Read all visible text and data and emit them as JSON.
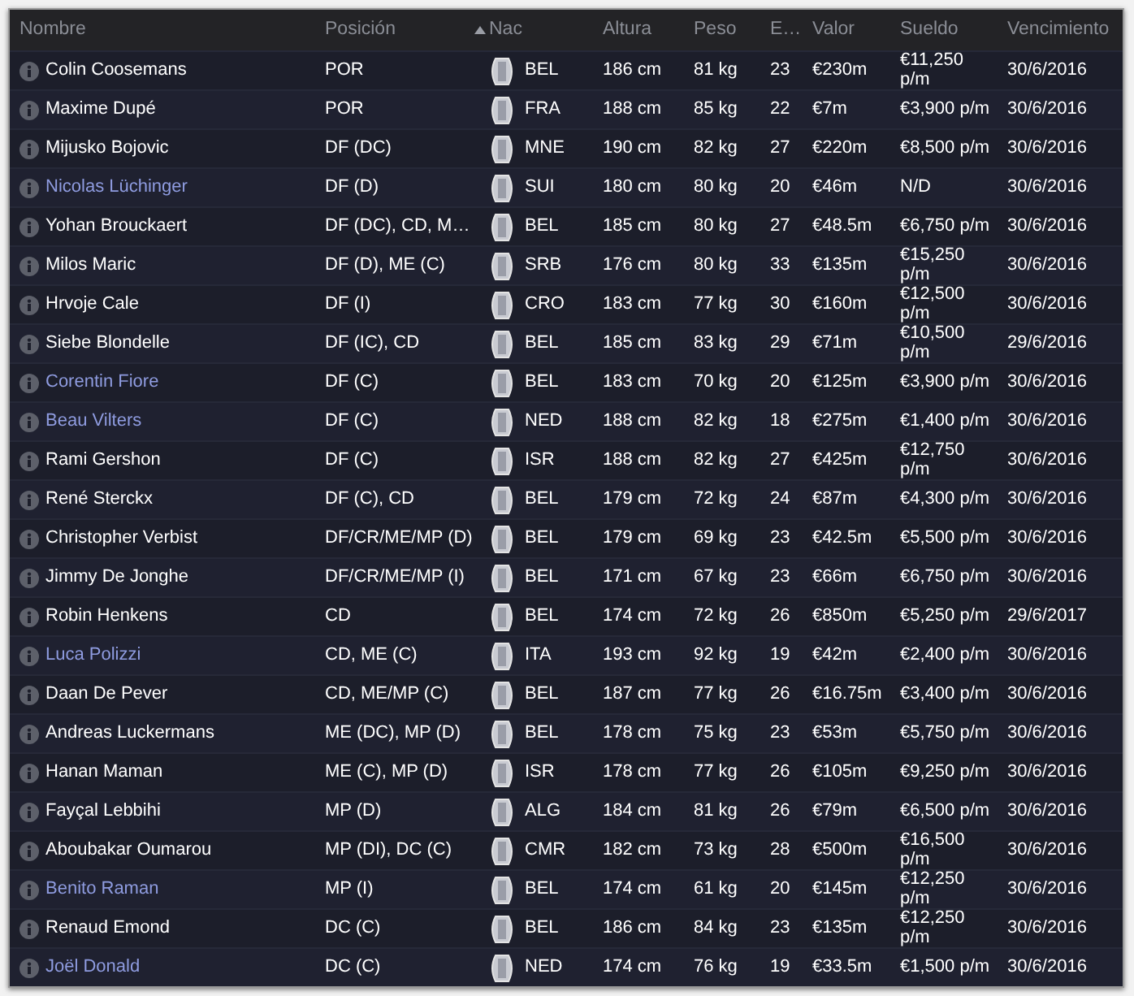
{
  "columns": [
    {
      "label": "Nombre",
      "sorted": false
    },
    {
      "label": "Posición",
      "sorted": false
    },
    {
      "label": "Nac",
      "sorted": true
    },
    {
      "label": "Altura",
      "sorted": false
    },
    {
      "label": "Peso",
      "sorted": false
    },
    {
      "label": "E…",
      "sorted": false
    },
    {
      "label": "Valor",
      "sorted": false
    },
    {
      "label": "Sueldo",
      "sorted": false
    },
    {
      "label": "Vencimiento",
      "sorted": false
    }
  ],
  "rows": [
    {
      "name": "Colin Coosemans",
      "color": "#ffffff",
      "position": "POR",
      "nation": "BEL",
      "height": "186 cm",
      "weight": "81 kg",
      "column_6": "23",
      "value": "€230m",
      "wage": "€11,250 p/m",
      "expiry": "30/6/2016"
    },
    {
      "name": "Maxime Dupé",
      "color": "#ffffff",
      "position": "POR",
      "nation": "FRA",
      "height": "188 cm",
      "weight": "85 kg",
      "column_6": "22",
      "value": "€7m",
      "wage": "€3,900 p/m",
      "expiry": "30/6/2016"
    },
    {
      "name": "Mijusko Bojovic",
      "color": "#ffffff",
      "position": "DF (DC)",
      "nation": "MNE",
      "height": "190 cm",
      "weight": "82 kg",
      "column_6": "27",
      "value": "€220m",
      "wage": "€8,500 p/m",
      "expiry": "30/6/2016"
    },
    {
      "name": "Nicolas Lüchinger",
      "color": "#8f9ce0",
      "position": "DF (D)",
      "nation": "SUI",
      "height": "180 cm",
      "weight": "80 kg",
      "column_6": "20",
      "value": "€46m",
      "wage": "N/D",
      "expiry": "30/6/2016"
    },
    {
      "name": "Yohan Brouckaert",
      "color": "#ffffff",
      "position": "DF (DC), CD, M…",
      "nation": "BEL",
      "height": "185 cm",
      "weight": "80 kg",
      "column_6": "27",
      "value": "€48.5m",
      "wage": "€6,750 p/m",
      "expiry": "30/6/2016"
    },
    {
      "name": "Milos Maric",
      "color": "#ffffff",
      "position": "DF (D), ME (C)",
      "nation": "SRB",
      "height": "176 cm",
      "weight": "80 kg",
      "column_6": "33",
      "value": "€135m",
      "wage": "€15,250 p/m",
      "expiry": "30/6/2016"
    },
    {
      "name": "Hrvoje Cale",
      "color": "#ffffff",
      "position": "DF (I)",
      "nation": "CRO",
      "height": "183 cm",
      "weight": "77 kg",
      "column_6": "30",
      "value": "€160m",
      "wage": "€12,500 p/m",
      "expiry": "30/6/2016"
    },
    {
      "name": "Siebe Blondelle",
      "color": "#ffffff",
      "position": "DF (IC), CD",
      "nation": "BEL",
      "height": "185 cm",
      "weight": "83 kg",
      "column_6": "29",
      "value": "€71m",
      "wage": "€10,500 p/m",
      "expiry": "29/6/2016"
    },
    {
      "name": "Corentin Fiore",
      "color": "#8f9ce0",
      "position": "DF (C)",
      "nation": "BEL",
      "height": "183 cm",
      "weight": "70 kg",
      "column_6": "20",
      "value": "€125m",
      "wage": "€3,900 p/m",
      "expiry": "30/6/2016"
    },
    {
      "name": "Beau Vilters",
      "color": "#8f9ce0",
      "position": "DF (C)",
      "nation": "NED",
      "height": "188 cm",
      "weight": "82 kg",
      "column_6": "18",
      "value": "€275m",
      "wage": "€1,400 p/m",
      "expiry": "30/6/2016"
    },
    {
      "name": "Rami Gershon",
      "color": "#ffffff",
      "position": "DF (C)",
      "nation": "ISR",
      "height": "188 cm",
      "weight": "82 kg",
      "column_6": "27",
      "value": "€425m",
      "wage": "€12,750 p/m",
      "expiry": "30/6/2016"
    },
    {
      "name": "René Sterckx",
      "color": "#ffffff",
      "position": "DF (C), CD",
      "nation": "BEL",
      "height": "179 cm",
      "weight": "72 kg",
      "column_6": "24",
      "value": "€87m",
      "wage": "€4,300 p/m",
      "expiry": "30/6/2016"
    },
    {
      "name": "Christopher Verbist",
      "color": "#ffffff",
      "position": "DF/CR/ME/MP (D)",
      "nation": "BEL",
      "height": "179 cm",
      "weight": "69 kg",
      "column_6": "23",
      "value": "€42.5m",
      "wage": "€5,500 p/m",
      "expiry": "30/6/2016"
    },
    {
      "name": "Jimmy De Jonghe",
      "color": "#ffffff",
      "position": "DF/CR/ME/MP (I)",
      "nation": "BEL",
      "height": "171 cm",
      "weight": "67 kg",
      "column_6": "23",
      "value": "€66m",
      "wage": "€6,750 p/m",
      "expiry": "30/6/2016"
    },
    {
      "name": "Robin Henkens",
      "color": "#ffffff",
      "position": "CD",
      "nation": "BEL",
      "height": "174 cm",
      "weight": "72 kg",
      "column_6": "26",
      "value": "€850m",
      "wage": "€5,250 p/m",
      "expiry": "29/6/2017"
    },
    {
      "name": "Luca Polizzi",
      "color": "#8f9ce0",
      "position": "CD, ME (C)",
      "nation": "ITA",
      "height": "193 cm",
      "weight": "92 kg",
      "column_6": "19",
      "value": "€42m",
      "wage": "€2,400 p/m",
      "expiry": "30/6/2016"
    },
    {
      "name": "Daan De Pever",
      "color": "#ffffff",
      "position": "CD, ME/MP (C)",
      "nation": "BEL",
      "height": "187 cm",
      "weight": "77 kg",
      "column_6": "26",
      "value": "€16.75m",
      "wage": "€3,400 p/m",
      "expiry": "30/6/2016"
    },
    {
      "name": "Andreas Luckermans",
      "color": "#ffffff",
      "position": "ME (DC), MP (D)",
      "nation": "BEL",
      "height": "178 cm",
      "weight": "75 kg",
      "column_6": "23",
      "value": "€53m",
      "wage": "€5,750 p/m",
      "expiry": "30/6/2016"
    },
    {
      "name": "Hanan Maman",
      "color": "#ffffff",
      "position": "ME (C), MP (D)",
      "nation": "ISR",
      "height": "178 cm",
      "weight": "77 kg",
      "column_6": "26",
      "value": "€105m",
      "wage": "€9,250 p/m",
      "expiry": "30/6/2016"
    },
    {
      "name": "Fayçal Lebbihi",
      "color": "#ffffff",
      "position": "MP (D)",
      "nation": "ALG",
      "height": "184 cm",
      "weight": "81 kg",
      "column_6": "26",
      "value": "€79m",
      "wage": "€6,500 p/m",
      "expiry": "30/6/2016"
    },
    {
      "name": "Aboubakar Oumarou",
      "color": "#ffffff",
      "position": "MP (DI), DC (C)",
      "nation": "CMR",
      "height": "182 cm",
      "weight": "73 kg",
      "column_6": "28",
      "value": "€500m",
      "wage": "€16,500 p/m",
      "expiry": "30/6/2016"
    },
    {
      "name": "Benito Raman",
      "color": "#8f9ce0",
      "position": "MP (I)",
      "nation": "BEL",
      "height": "174 cm",
      "weight": "61 kg",
      "column_6": "20",
      "value": "€145m",
      "wage": "€12,250 p/m",
      "expiry": "30/6/2016"
    },
    {
      "name": "Renaud Emond",
      "color": "#ffffff",
      "position": "DC (C)",
      "nation": "BEL",
      "height": "186 cm",
      "weight": "84 kg",
      "column_6": "23",
      "value": "€135m",
      "wage": "€12,250 p/m",
      "expiry": "30/6/2016"
    },
    {
      "name": "Joël Donald",
      "color": "#8f9ce0",
      "position": "DC (C)",
      "nation": "NED",
      "height": "174 cm",
      "weight": "76 kg",
      "column_6": "19",
      "value": "€33.5m",
      "wage": "€1,500 p/m",
      "expiry": "30/6/2016"
    }
  ]
}
